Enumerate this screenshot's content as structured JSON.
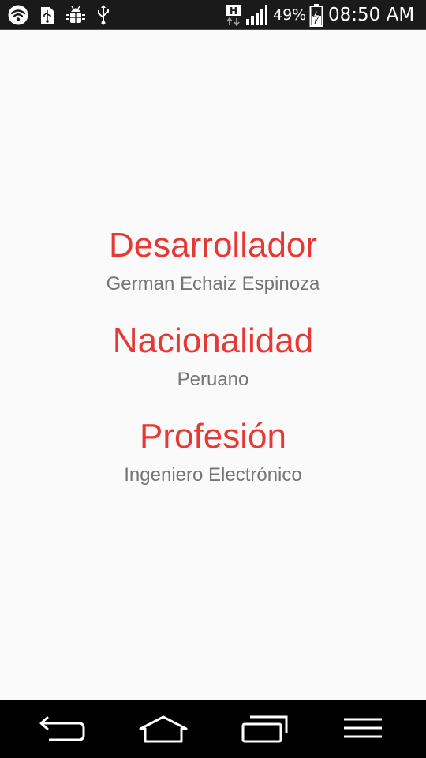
{
  "status_bar": {
    "icons": [
      "wifi-icon",
      "usb-storage-icon",
      "android-debug-icon",
      "usb-icon",
      "hspa-data-icon",
      "signal-strength-icon",
      "battery-charging-icon"
    ],
    "network_label": "H",
    "battery_percent": "49%",
    "time": "08:50 AM"
  },
  "main": {
    "sections": [
      {
        "title": "Desarrollador",
        "value": "German Echaiz Espinoza"
      },
      {
        "title": "Nacionalidad",
        "value": "Peruano"
      },
      {
        "title": "Profesión",
        "value": "Ingeniero Electrónico"
      }
    ]
  },
  "navigation_bar": {
    "buttons": [
      "back-icon",
      "home-icon",
      "recent-apps-icon",
      "menu-icon"
    ]
  },
  "colors": {
    "accent": "#e53935",
    "secondary_text": "#757575",
    "background": "#fafafa",
    "status_bar": "#1a1a1a",
    "navigation_bar": "#000000"
  }
}
